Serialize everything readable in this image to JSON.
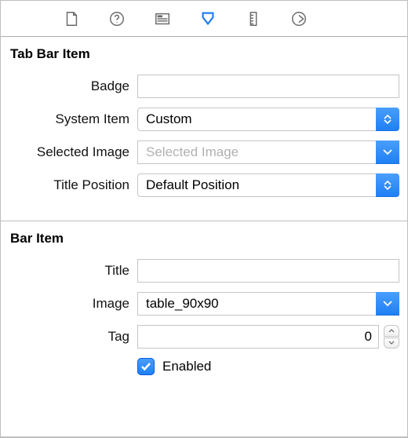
{
  "toolbar": {
    "items": [
      "file",
      "help",
      "identity",
      "attributes",
      "size",
      "connections"
    ],
    "selected": 3
  },
  "sections": {
    "tabbar": {
      "title": "Tab Bar Item",
      "badge_label": "Badge",
      "badge_value": "",
      "system_item_label": "System Item",
      "system_item_value": "Custom",
      "selected_image_label": "Selected Image",
      "selected_image_value": "",
      "selected_image_placeholder": "Selected Image",
      "title_position_label": "Title Position",
      "title_position_value": "Default Position"
    },
    "baritem": {
      "title": "Bar Item",
      "title_label": "Title",
      "title_value": "",
      "image_label": "Image",
      "image_value": "table_90x90",
      "tag_label": "Tag",
      "tag_value": "0",
      "enabled_label": "Enabled",
      "enabled_checked": true
    }
  }
}
